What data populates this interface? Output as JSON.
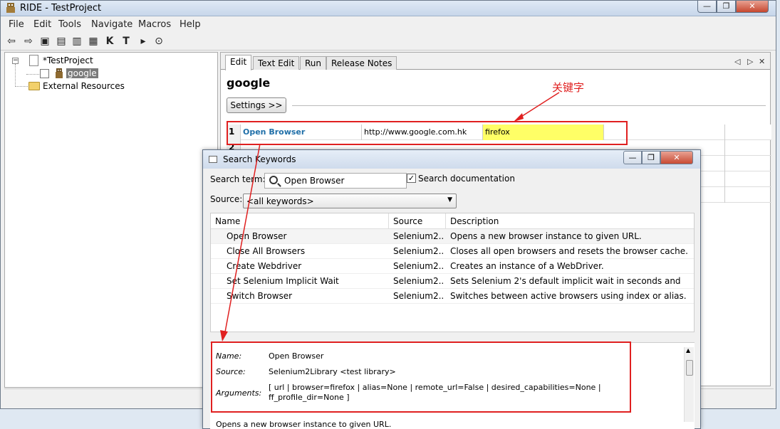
{
  "window": {
    "title": "RIDE - TestProject",
    "min": "—",
    "max": "❐",
    "close": "✕"
  },
  "menu": [
    "File",
    "Edit",
    "Tools",
    "Navigate",
    "Macros",
    "Help"
  ],
  "toolbar": {
    "back": "⇦",
    "forward": "⇨",
    "open_dir": "▣",
    "open": "▤",
    "save": "▥",
    "save_all": "▦",
    "keyword": "K",
    "test": "T",
    "run": "▸",
    "stop": "⊙"
  },
  "tree": {
    "project": "*TestProject",
    "suite": "google",
    "external": "External Resources",
    "expand": "−"
  },
  "editor": {
    "tabs": [
      "Edit",
      "Text Edit",
      "Run",
      "Release Notes"
    ],
    "nav": [
      "◁",
      "▷",
      "✕"
    ],
    "title": "google",
    "settings_btn": "Settings >>",
    "row": {
      "num": "1",
      "keyword": "Open Browser",
      "arg1": "http://www.google.com.hk",
      "arg2": "firefox"
    },
    "row2_num": "2"
  },
  "annotation": {
    "text": "关键字"
  },
  "dialog": {
    "title": "Search Keywords",
    "search_label": "Search term:",
    "search_value": "Open Browser",
    "doc_check": "✓",
    "doc_label": "Search documentation",
    "source_label": "Source:",
    "source_value": "<all keywords>",
    "source_arrow": "▼",
    "columns": [
      "Name",
      "Source",
      "Description"
    ],
    "rows": [
      {
        "name": "Open Browser",
        "source": "Selenium2...",
        "desc": "Opens a new browser instance to given URL."
      },
      {
        "name": "Close All Browsers",
        "source": "Selenium2...",
        "desc": "Closes all open browsers and resets the browser cache."
      },
      {
        "name": "Create Webdriver",
        "source": "Selenium2...",
        "desc": "Creates an instance of a WebDriver."
      },
      {
        "name": "Set Selenium Implicit Wait",
        "source": "Selenium2...",
        "desc": "Sets Selenium 2's default implicit wait in seconds and"
      },
      {
        "name": "Switch Browser",
        "source": "Selenium2...",
        "desc": "Switches between active browsers using index or alias."
      }
    ],
    "details": {
      "name_key": "Name:",
      "name_val": "Open Browser",
      "source_key": "Source:",
      "source_val": "Selenium2Library <test library>",
      "args_key": "Arguments:",
      "args_val1": "[ url | browser=firefox | alias=None | remote_url=False | desired_capabilities=None |",
      "args_val2": "ff_profile_dir=None ]",
      "doc": "Opens a new browser instance to given URL."
    },
    "scroll_up": "▲",
    "scroll_down": "▼"
  },
  "colors": {
    "accent_red": "#e02020",
    "keyword_blue": "#1f6fa8",
    "arg_yellow": "#ffff66"
  }
}
